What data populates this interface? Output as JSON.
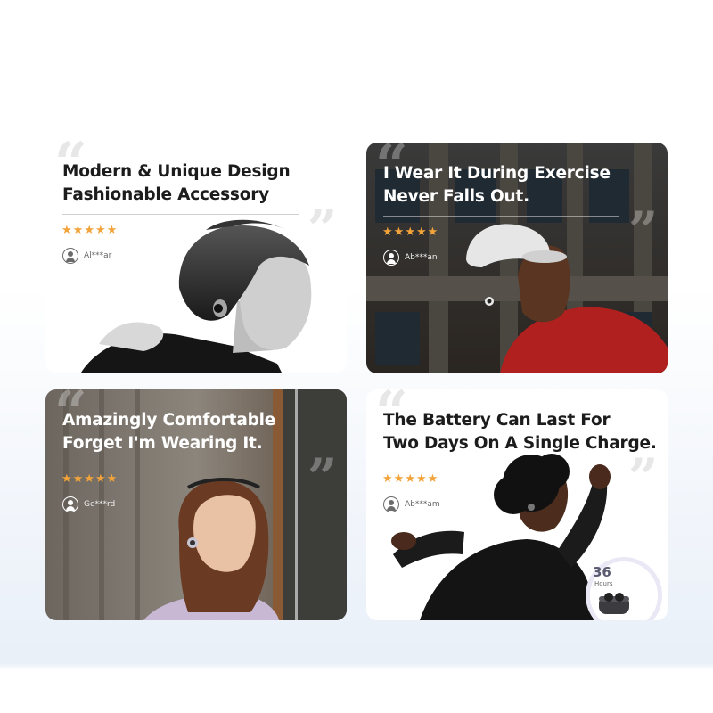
{
  "accent": {
    "star_color": "#f2a33a"
  },
  "cards": [
    {
      "title_line1": "Modern & Unique Design",
      "title_line2": "Fashionable Accessory",
      "rating": 5,
      "reviewer": "Al***ar",
      "theme": "light"
    },
    {
      "title_line1": "I Wear It During Exercise",
      "title_line2": "Never Falls Out.",
      "rating": 5,
      "reviewer": "Ab***an",
      "theme": "dark"
    },
    {
      "title_line1": "Amazingly Comfortable",
      "title_line2": "Forget I'm Wearing It.",
      "rating": 5,
      "reviewer": "Ge***rd",
      "theme": "dark"
    },
    {
      "title_line1": "The Battery Can Last For",
      "title_line2": "Two Days On A Single Charge.",
      "rating": 5,
      "reviewer": "Ab***am",
      "theme": "light",
      "battery": {
        "value": "36",
        "unit": "Hours"
      }
    }
  ],
  "icons": {
    "quote_open": "“",
    "quote_close": "”",
    "star": "★",
    "avatar": "user-avatar-icon",
    "case": "earbuds-case-icon"
  }
}
